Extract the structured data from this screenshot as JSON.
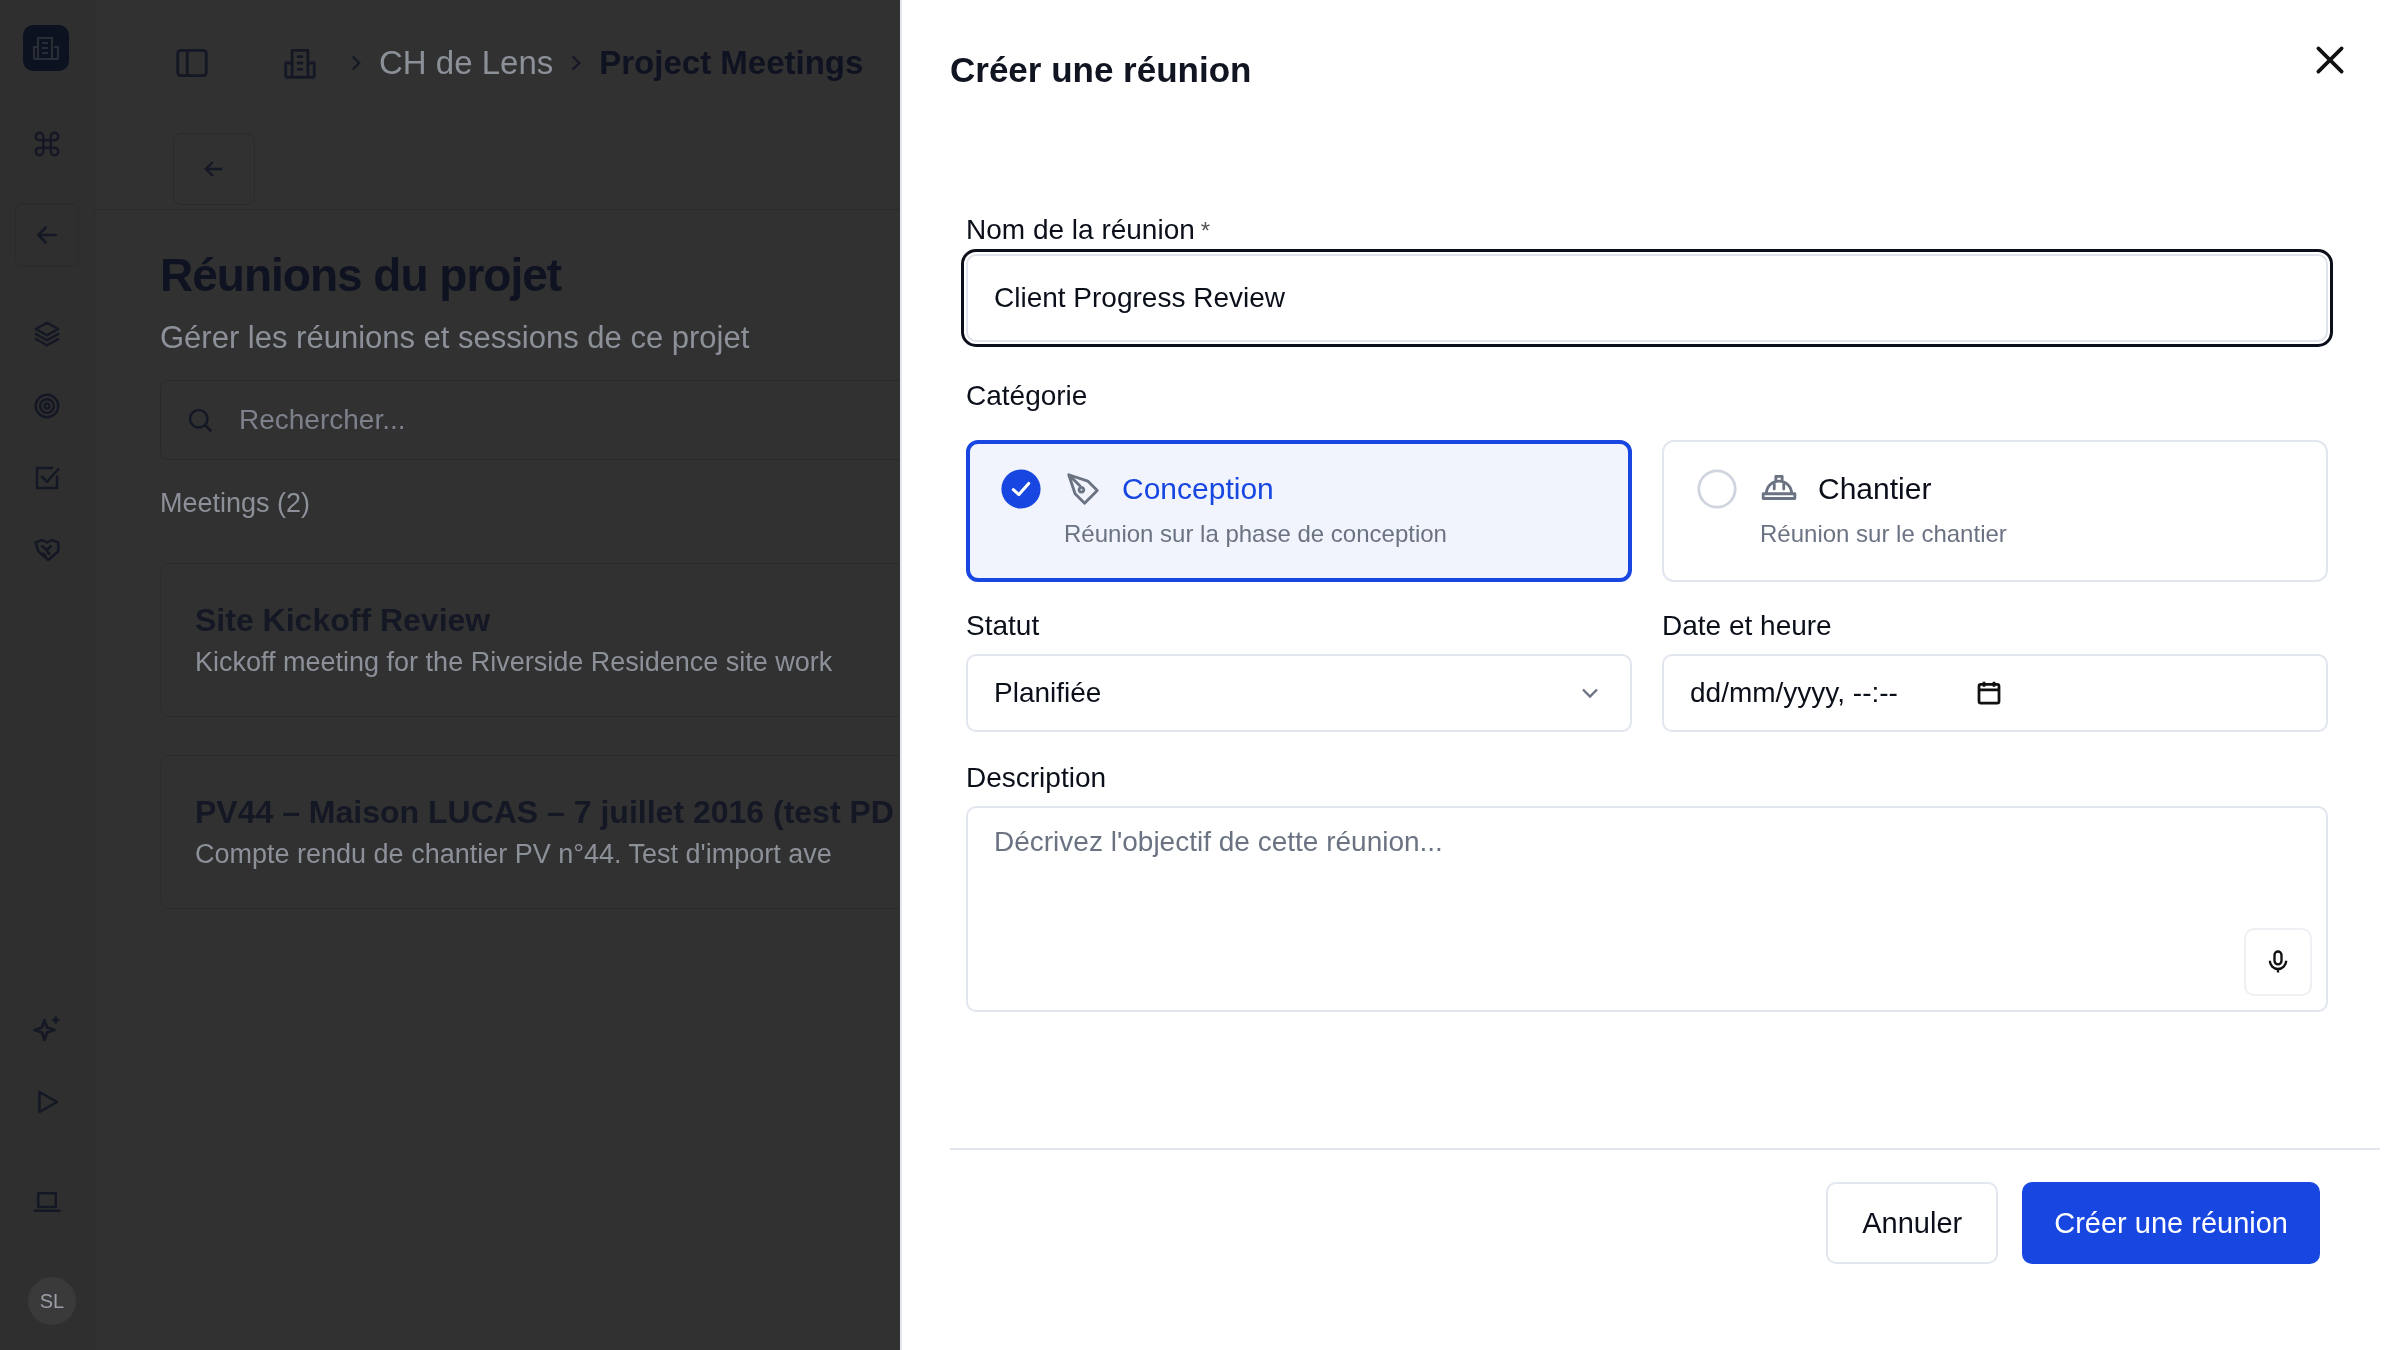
{
  "sidebar": {
    "avatar": "SL"
  },
  "breadcrumb": [
    {
      "label": "CH de Lens",
      "current": false
    },
    {
      "label": "Project Meetings",
      "current": true
    }
  ],
  "page": {
    "title": "Réunions du projet",
    "subtitle": "Gérer les réunions et sessions de ce projet",
    "search": {
      "placeholder": "Rechercher..."
    },
    "count": "Meetings (2)",
    "meetings": [
      {
        "title": "Site Kickoff Review",
        "description": "Kickoff meeting for the Riverside Residence site work"
      },
      {
        "title": "PV44 – Maison LUCAS – 7 juillet 2016 (test PD",
        "description": "Compte rendu de chantier PV n°44. Test d'import ave"
      }
    ]
  },
  "dialog": {
    "title": "Créer une réunion",
    "name_field": {
      "label": "Nom de la réunion",
      "required_mark": "*",
      "value": "Client Progress Review"
    },
    "category": {
      "label": "Catégorie",
      "options": [
        {
          "kind": "design",
          "title": "Conception",
          "description": "Réunion sur la phase de conception",
          "selected": true
        },
        {
          "kind": "site",
          "title": "Chantier",
          "description": "Réunion sur le chantier",
          "selected": false
        }
      ]
    },
    "status": {
      "label": "Statut",
      "value": "Planifiée"
    },
    "date": {
      "label": "Date et heure",
      "value": "dd/mm/yyyy, --:--"
    },
    "description": {
      "label": "Description",
      "placeholder": "Décrivez l'objectif de cette réunion..."
    },
    "buttons": [
      {
        "kind": "secondary",
        "label": "Annuler"
      },
      {
        "kind": "primary",
        "label": "Créer une réunion"
      }
    ]
  }
}
